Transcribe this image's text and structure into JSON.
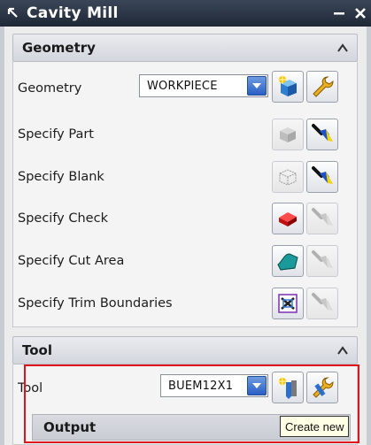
{
  "window": {
    "title": "Cavity Mill"
  },
  "geometry_section": {
    "header": "Geometry",
    "geometry_label": "Geometry",
    "geometry_value": "WORKPIECE",
    "rows": [
      {
        "label": "Specify Part"
      },
      {
        "label": "Specify Blank"
      },
      {
        "label": "Specify Check"
      },
      {
        "label": "Specify Cut Area"
      },
      {
        "label": "Specify Trim Boundaries"
      }
    ]
  },
  "tool_section": {
    "header": "Tool",
    "tool_label": "Tool",
    "tool_value": "BUEM12X1"
  },
  "output_section": {
    "header": "Output"
  },
  "tooltip": {
    "text": "Create new"
  },
  "colors": {
    "highlight": "#e0141c",
    "titlebar": "#1f2836",
    "dropdown": "#2a5fc4"
  }
}
